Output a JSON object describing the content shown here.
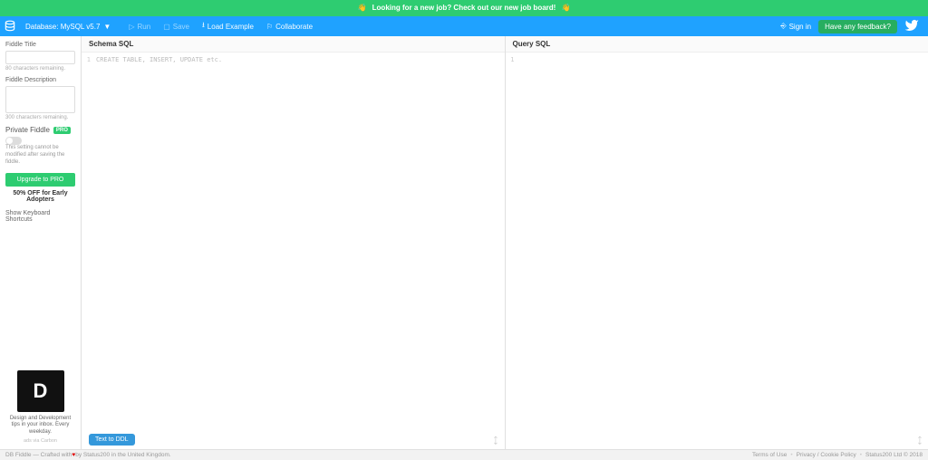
{
  "announce": {
    "text": "Looking for a new job? Check out our new job board!",
    "emoji": "👋"
  },
  "topbar": {
    "db_label": "Database: MySQL v5.7",
    "run": "Run",
    "save": "Save",
    "load": "Load Example",
    "collab": "Collaborate",
    "signin": "Sign in",
    "feedback": "Have any feedback?"
  },
  "sidebar": {
    "title_label": "Fiddle Title",
    "title_hint": "80 characters remaining.",
    "desc_label": "Fiddle Description",
    "desc_hint": "300 characters remaining.",
    "private_label": "Private Fiddle",
    "pro_badge": "PRO",
    "private_note": "This setting cannot be modified after saving the fiddle.",
    "upgrade": "Upgrade to PRO",
    "discount": "50% OFF for Early Adopters",
    "shortcuts": "Show Keyboard Shortcuts",
    "promo_letter": "D",
    "promo_text": "Design and Development tips in your inbox. Every weekday.",
    "promo_sub": "ads via Carbon"
  },
  "schema": {
    "header": "Schema SQL",
    "placeholder": "CREATE TABLE, INSERT, UPDATE etc.",
    "line": "1",
    "text2ddl": "Text to DDL"
  },
  "query": {
    "header": "Query SQL",
    "line": "1"
  },
  "footer": {
    "left1": "DB Fiddle — Crafted with ",
    "left2": " by Status200 in the United Kingdom.",
    "heart": "♥",
    "terms": "Terms of Use",
    "privacy": "Privacy / Cookie Policy",
    "copyright": "Status200 Ltd © 2018"
  }
}
